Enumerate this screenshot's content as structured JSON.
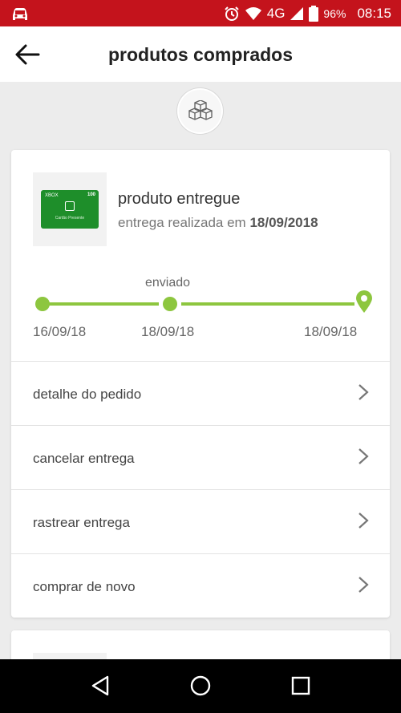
{
  "status_bar": {
    "network": "4G",
    "battery": "96%",
    "time": "08:15",
    "background_color": "#c4131c"
  },
  "app_bar": {
    "title": "produtos comprados",
    "back_icon": "arrow-left-icon"
  },
  "order": {
    "status_title": "produto entregue",
    "status_prefix": "entrega realizada em",
    "status_date": "18/09/2018",
    "product_image": "xbox-gift-card"
  },
  "timeline": {
    "current_step_label": "enviado",
    "accent_color": "#8dc63f",
    "dates": [
      "16/09/18",
      "18/09/18",
      "18/09/18"
    ]
  },
  "actions": [
    {
      "label": "detalhe do pedido",
      "icon": "chevron-right-icon"
    },
    {
      "label": "cancelar entrega",
      "icon": "chevron-right-icon"
    },
    {
      "label": "rastrear entrega",
      "icon": "chevron-right-icon"
    },
    {
      "label": "comprar de novo",
      "icon": "chevron-right-icon"
    }
  ],
  "navigation": {
    "back": "nav-back-icon",
    "home": "nav-home-icon",
    "recents": "nav-recents-icon"
  }
}
